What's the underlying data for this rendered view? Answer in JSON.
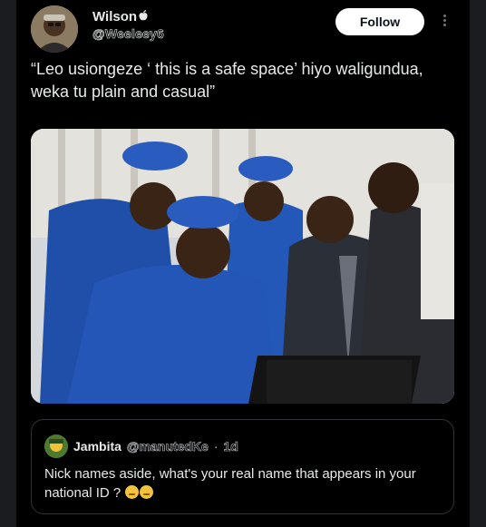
{
  "tweet": {
    "author": {
      "display_name": "Wilson",
      "badge_icon": "apple-icon",
      "handle": "@Weeleey6"
    },
    "follow_label": "Follow",
    "more_icon": "more-vertical-icon",
    "text": "“Leo usiongeze ‘ this is a safe space’ hiyo waligundua, weka tu plain and casual”"
  },
  "quote": {
    "author": {
      "display_name": "Jambita",
      "handle": "@manutedKe",
      "separator": "·",
      "time": "1d"
    },
    "text": "Nick names aside, what's your real name that appears in your national ID ?",
    "emojis": [
      "grimace-emoji-icon",
      "grimace-emoji-icon"
    ]
  },
  "colors": {
    "background": "#000000",
    "text": "#e7e9ea",
    "follow_bg": "#ffffff",
    "uniform": "#1f4fa8"
  }
}
